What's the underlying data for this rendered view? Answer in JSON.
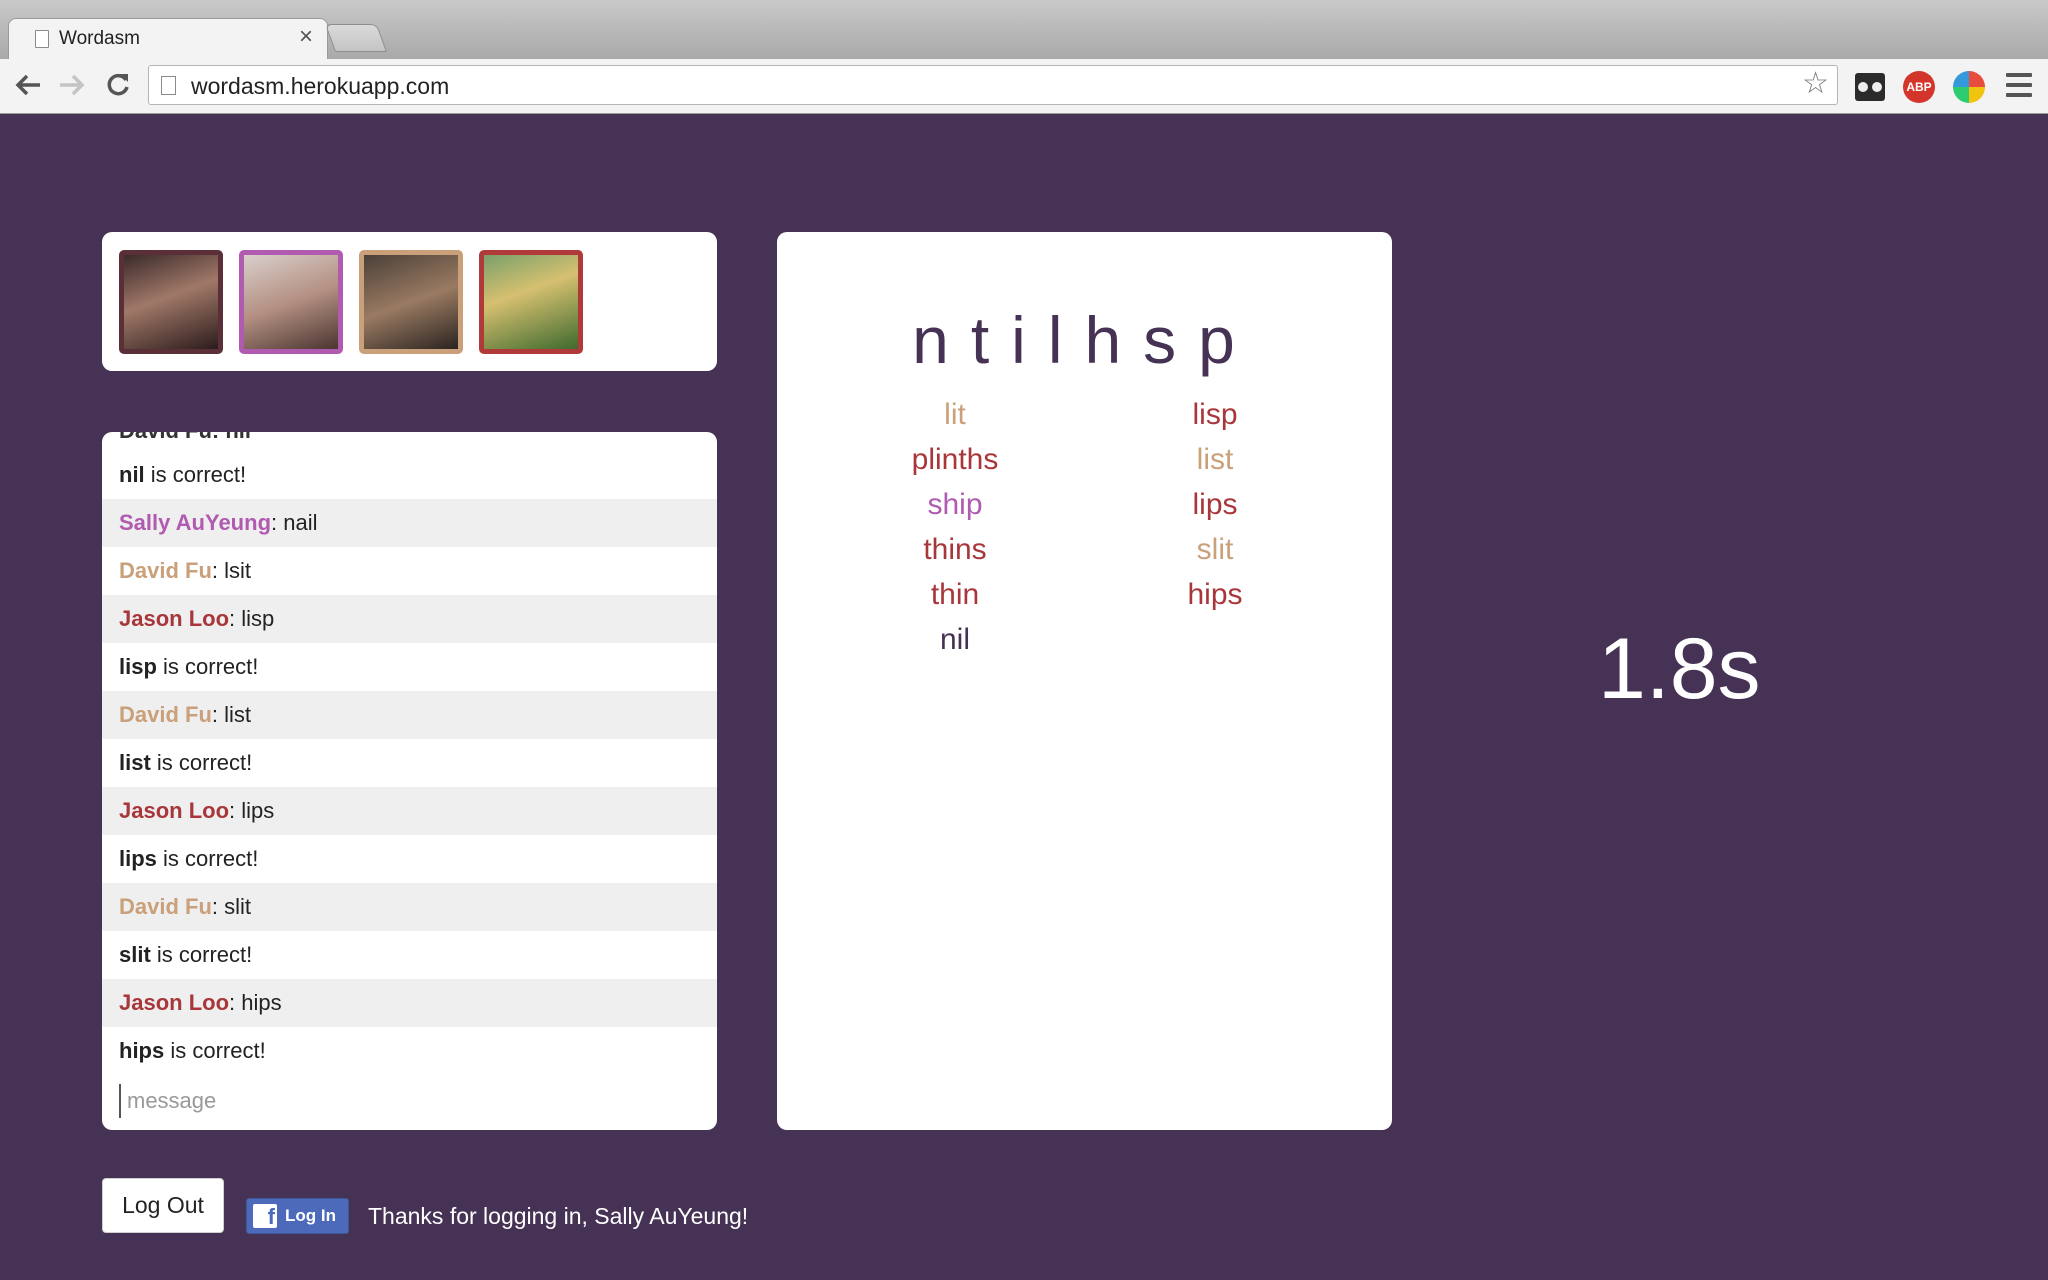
{
  "browser": {
    "tab_title": "Wordasm",
    "tab_close": "×",
    "url": "wordasm.herokuapp.com",
    "ext_abp": "ABP"
  },
  "players": [
    {
      "border": "#5a2f38",
      "bg": "linear-gradient(160deg,#3b2a2a,#a07868 45%,#2c1c1c)"
    },
    {
      "border": "#b05ab0",
      "bg": "linear-gradient(160deg,#d9cfcc,#b49082 50%,#4a3530)"
    },
    {
      "border": "#c9a07a",
      "bg": "linear-gradient(160deg,#4a4038,#9a7a62 50%,#2a2420)"
    },
    {
      "border": "#b03a3a",
      "bg": "linear-gradient(160deg,#7aa06a,#d6c070 40%,#3e6a2e)"
    }
  ],
  "chat": {
    "cutoff": "David Fu: nil",
    "placeholder": "message",
    "messages": [
      {
        "name": "nil",
        "rest": " is correct!",
        "color": "#222222",
        "alt": false
      },
      {
        "name": "Sally AuYeung",
        "rest": ": nail",
        "color": "#b05ab0",
        "alt": true
      },
      {
        "name": "David Fu",
        "rest": ": lsit",
        "color": "#c9a07a",
        "alt": false
      },
      {
        "name": "Jason Loo",
        "rest": ": lisp",
        "color": "#a8363a",
        "alt": true
      },
      {
        "name": "lisp",
        "rest": " is correct!",
        "color": "#222222",
        "alt": false
      },
      {
        "name": "David Fu",
        "rest": ": list",
        "color": "#c9a07a",
        "alt": true
      },
      {
        "name": "list",
        "rest": " is correct!",
        "color": "#222222",
        "alt": false
      },
      {
        "name": "Jason Loo",
        "rest": ": lips",
        "color": "#a8363a",
        "alt": true
      },
      {
        "name": "lips",
        "rest": " is correct!",
        "color": "#222222",
        "alt": false
      },
      {
        "name": "David Fu",
        "rest": ": slit",
        "color": "#c9a07a",
        "alt": true
      },
      {
        "name": "slit",
        "rest": " is correct!",
        "color": "#222222",
        "alt": false
      },
      {
        "name": "Jason Loo",
        "rest": ": hips",
        "color": "#a8363a",
        "alt": true
      },
      {
        "name": "hips",
        "rest": " is correct!",
        "color": "#222222",
        "alt": false
      }
    ]
  },
  "board": {
    "letters": "ntilhsp",
    "col1": [
      {
        "w": "lit",
        "c": "#c9a07a"
      },
      {
        "w": "plinths",
        "c": "#a8363a"
      },
      {
        "w": "ship",
        "c": "#b05ab0"
      },
      {
        "w": "thins",
        "c": "#a8363a"
      },
      {
        "w": "thin",
        "c": "#a8363a"
      },
      {
        "w": "nil",
        "c": "#453254"
      }
    ],
    "col2": [
      {
        "w": "lisp",
        "c": "#a8363a"
      },
      {
        "w": "list",
        "c": "#c9a07a"
      },
      {
        "w": "lips",
        "c": "#a8363a"
      },
      {
        "w": "slit",
        "c": "#c9a07a"
      },
      {
        "w": "hips",
        "c": "#a8363a"
      }
    ]
  },
  "timer": "1.8s",
  "footer": {
    "logout_label": "Log Out",
    "fb_label": "Log In",
    "thanks": "Thanks for logging in, Sally AuYeung!"
  }
}
